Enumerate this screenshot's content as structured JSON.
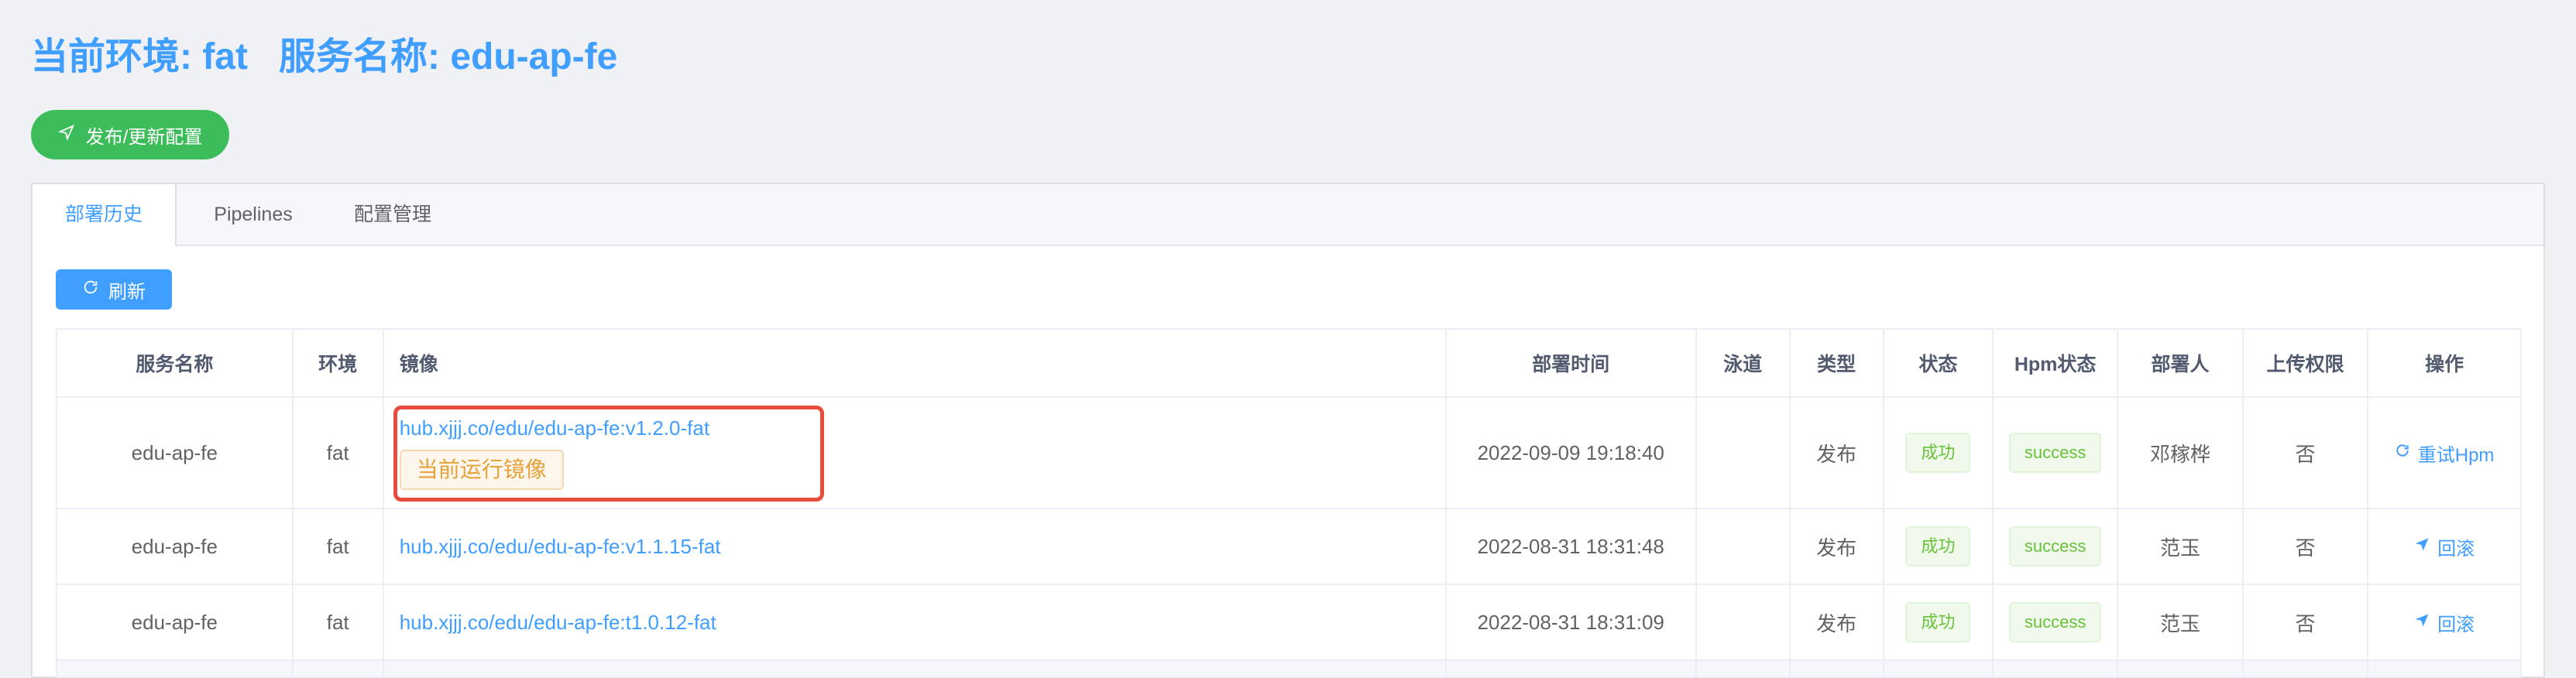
{
  "header": {
    "title": "当前环境: fat   服务名称: edu-ap-fe",
    "publish_label": "发布/更新配置"
  },
  "tabs": [
    {
      "label": "部署历史",
      "active": true
    },
    {
      "label": "Pipelines",
      "active": false
    },
    {
      "label": "配置管理",
      "active": false
    }
  ],
  "toolbar": {
    "refresh_label": "刷新"
  },
  "table": {
    "columns": [
      "服务名称",
      "环境",
      "镜像",
      "部署时间",
      "泳道",
      "类型",
      "状态",
      "Hpm状态",
      "部署人",
      "上传权限",
      "操作"
    ],
    "rows": [
      {
        "service": "edu-ap-fe",
        "env": "fat",
        "image": "hub.xjjj.co/edu/edu-ap-fe:v1.2.0-fat",
        "image_tag": "当前运行镜像",
        "time": "2022-09-09 19:18:40",
        "lane": "",
        "type": "发布",
        "status": "成功",
        "hpm_status": "success",
        "deployer": "邓稼桦",
        "upload": "否",
        "action": "重试Hpm"
      },
      {
        "service": "edu-ap-fe",
        "env": "fat",
        "image": "hub.xjjj.co/edu/edu-ap-fe:v1.1.15-fat",
        "time": "2022-08-31 18:31:48",
        "lane": "",
        "type": "发布",
        "status": "成功",
        "hpm_status": "success",
        "deployer": "范玉",
        "upload": "否",
        "action": "回滚"
      },
      {
        "service": "edu-ap-fe",
        "env": "fat",
        "image": "hub.xjjj.co/edu/edu-ap-fe:t1.0.12-fat",
        "time": "2022-08-31 18:31:09",
        "lane": "",
        "type": "发布",
        "status": "成功",
        "hpm_status": "success",
        "deployer": "范玉",
        "upload": "否",
        "action": "回滚"
      }
    ]
  },
  "colors": {
    "primary": "#409eff",
    "success_button": "#3dbd5a",
    "highlight_border": "#e74c3c",
    "warning_tag": "#e6a23c"
  }
}
